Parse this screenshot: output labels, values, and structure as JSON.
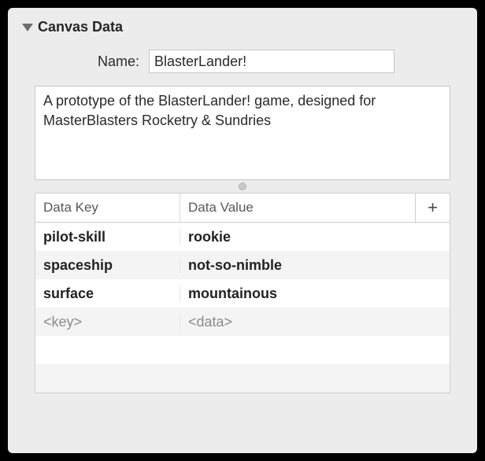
{
  "section": {
    "title": "Canvas Data"
  },
  "name": {
    "label": "Name:",
    "value": "BlasterLander!"
  },
  "description": {
    "value": "A prototype of the BlasterLander! game, designed for MasterBlasters Rocketry & Sundries"
  },
  "table": {
    "header_key": "Data Key",
    "header_value": "Data Value",
    "rows": [
      {
        "key": "pilot-skill",
        "value": "rookie"
      },
      {
        "key": "spaceship",
        "value": "not-so-nimble"
      },
      {
        "key": "surface",
        "value": "mountainous"
      }
    ],
    "placeholder_key": "<key>",
    "placeholder_value": "<data>"
  }
}
